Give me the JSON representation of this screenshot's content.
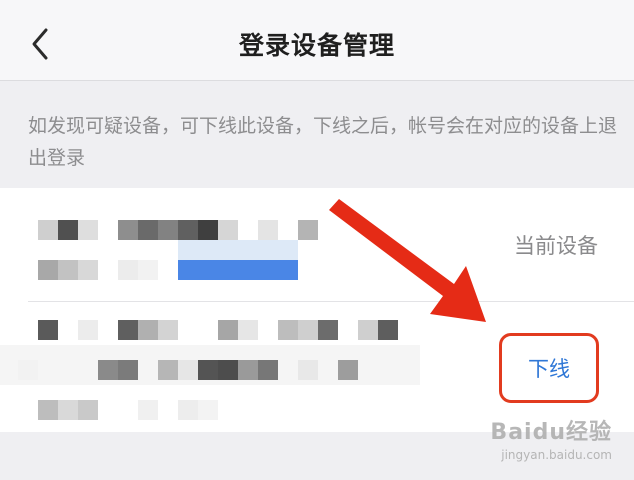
{
  "header": {
    "title": "登录设备管理",
    "back_icon": "chevron-left-icon"
  },
  "tip": "如发现可疑设备，可下线此设备，下线之后，帐号会在对应的设备上退出登录",
  "devices": [
    {
      "status_label": "当前设备"
    },
    {
      "action_label": "下线"
    }
  ],
  "annotation": {
    "arrow_color": "#e52b16",
    "highlight_color": "#e23b1f"
  },
  "watermark": {
    "brand": "Baidu经验",
    "url": "jingyan.baidu.com"
  }
}
